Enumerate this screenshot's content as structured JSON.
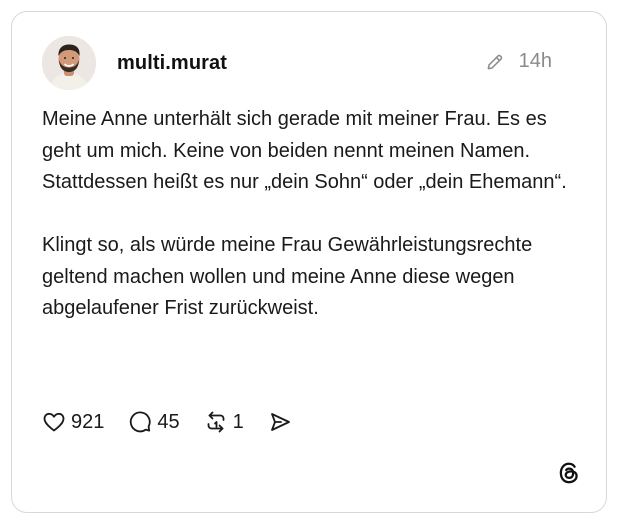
{
  "post": {
    "username": "multi.murat",
    "timestamp": "14h",
    "paragraphs": [
      "Meine Anne unterhält sich gerade mit meiner Frau. Es es geht um mich. Keine von beiden nennt meinen Namen. Stattdessen heißt es nur „dein Sohn“ oder „dein Ehemann“.",
      "Klingt so, als würde meine Frau Gewährleistungsrechte geltend machen wollen und meine Anne diese wegen abgelaufener Frist zurückweist."
    ]
  },
  "actions": {
    "likes": "921",
    "comments": "45",
    "reposts": "1"
  },
  "icons": {
    "edit": "pencil-icon",
    "like": "heart-icon",
    "comment": "comment-icon",
    "repost": "repost-icon",
    "share": "send-icon",
    "brand": "threads-logo-icon"
  }
}
